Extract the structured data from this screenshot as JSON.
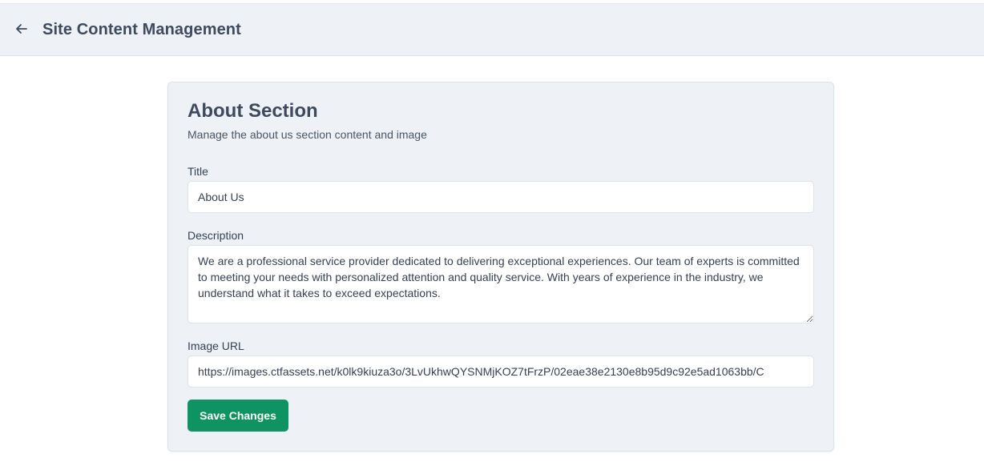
{
  "header": {
    "back_icon": "arrow-left-icon",
    "title": "Site Content Management"
  },
  "section": {
    "title": "About Section",
    "subtitle": "Manage the about us section content and image",
    "fields": {
      "title": {
        "label": "Title",
        "value": "About Us"
      },
      "description": {
        "label": "Description",
        "value": "We are a professional service provider dedicated to delivering exceptional experiences. Our team of experts is committed to meeting your needs with personalized attention and quality service. With years of experience in the industry, we understand what it takes to exceed expectations."
      },
      "image_url": {
        "label": "Image URL",
        "value": "https://images.ctfassets.net/k0lk9kiuza3o/3LvUkhwQYSNMjKOZ7tFrzP/02eae38e2130e8b95d9c92e5ad1063bb/C"
      }
    },
    "save_label": "Save Changes"
  },
  "colors": {
    "header_bg": "#eef2f7",
    "card_bg": "#eef2f7",
    "primary_button": "#0f9363",
    "title_text": "#3f4a5c"
  }
}
